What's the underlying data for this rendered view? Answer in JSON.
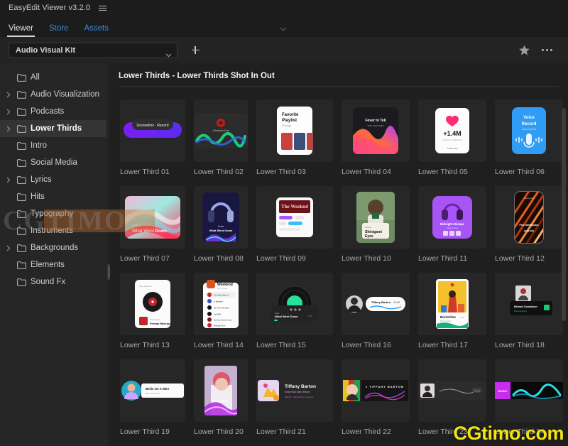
{
  "window": {
    "title": "EasyEdit Viewer v3.2.0",
    "menu_icon": "hamburger-icon"
  },
  "tabs": [
    {
      "label": "Viewer",
      "active": true
    },
    {
      "label": "Store",
      "active": false
    },
    {
      "label": "Assets",
      "active": false
    }
  ],
  "toolbar": {
    "kit_selected": "Audio Visual Kit",
    "kit_chevron_icon": "chevron-down-icon",
    "add_icon": "plus-icon",
    "favorite_icon": "star-icon",
    "overflow_icon": "more-options-icon"
  },
  "sidebar": {
    "items": [
      {
        "label": "All",
        "expandable": false,
        "selected": false
      },
      {
        "label": "Audio Visualization",
        "expandable": true,
        "selected": false
      },
      {
        "label": "Podcasts",
        "expandable": true,
        "selected": false
      },
      {
        "label": "Lower Thirds",
        "expandable": true,
        "selected": true
      },
      {
        "label": "Intro",
        "expandable": false,
        "selected": false
      },
      {
        "label": "Social Media",
        "expandable": false,
        "selected": false
      },
      {
        "label": "Lyrics",
        "expandable": true,
        "selected": false
      },
      {
        "label": "Hits",
        "expandable": false,
        "selected": false
      },
      {
        "label": "Typography",
        "expandable": false,
        "selected": false
      },
      {
        "label": "Instruments",
        "expandable": false,
        "selected": false
      },
      {
        "label": "Backgrounds",
        "expandable": true,
        "selected": false
      },
      {
        "label": "Elements",
        "expandable": false,
        "selected": false
      },
      {
        "label": "Sound Fx",
        "expandable": false,
        "selected": false
      }
    ]
  },
  "content": {
    "header": "Lower Thirds - Lower Thirds Shot In Out",
    "items": [
      {
        "label": "Lower Third 01",
        "art": "pill-purple"
      },
      {
        "label": "Lower Third 02",
        "art": "wave-green"
      },
      {
        "label": "Lower Third 03",
        "art": "card-playlist"
      },
      {
        "label": "Lower Third 04",
        "art": "wave-pink"
      },
      {
        "label": "Lower Third 05",
        "art": "card-likes"
      },
      {
        "label": "Lower Third 06",
        "art": "card-voice"
      },
      {
        "label": "Lower Third 07",
        "art": "swirl-pastel"
      },
      {
        "label": "Lower Third 08",
        "art": "headphones-blue"
      },
      {
        "label": "Lower Third 09",
        "art": "card-tags"
      },
      {
        "label": "Lower Third 10",
        "art": "portrait-card"
      },
      {
        "label": "Lower Third 11",
        "art": "headphones-purple"
      },
      {
        "label": "Lower Third 12",
        "art": "phone-stripes"
      },
      {
        "label": "Lower Third 13",
        "art": "card-vinyl"
      },
      {
        "label": "Lower Third 14",
        "art": "card-list"
      },
      {
        "label": "Lower Third 15",
        "art": "vinyl-player"
      },
      {
        "label": "Lower Third 16",
        "art": "avatar-bar"
      },
      {
        "label": "Lower Third 17",
        "art": "poster-yellow"
      },
      {
        "label": "Lower Third 18",
        "art": "badge-dark"
      },
      {
        "label": "Lower Third 19",
        "art": "circle-bar"
      },
      {
        "label": "Lower Third 20",
        "art": "poster-pink"
      },
      {
        "label": "Lower Third 21",
        "art": "profile-row"
      },
      {
        "label": "Lower Third 22",
        "art": "banner-wave"
      },
      {
        "label": "Lower Third 23",
        "art": "bar-line"
      },
      {
        "label": "Lower Third 24",
        "art": "bar-cyan"
      }
    ]
  },
  "watermarks": {
    "overlay": "CGTIMO",
    "corner": "CGtimo.com"
  },
  "colors": {
    "tab_active": "#e3e3e3",
    "tab_inactive": "#3f87d6",
    "accent_watermark": "#f2e414",
    "panel_bg": "#232323",
    "sidebar_bg": "#262626",
    "content_bg": "#1f1f1f"
  }
}
